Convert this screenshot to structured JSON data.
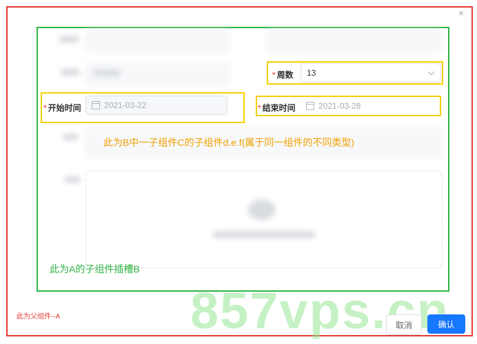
{
  "dialog": {
    "close_symbol": "×",
    "parent_note": "此为父组件--A",
    "slot_note": "此为A的子组件插槽B",
    "child_note": "此为B中一子组件C的子组件d.e.f(属于同一组件的不同类型)"
  },
  "form": {
    "weeks": {
      "required": "*",
      "label": "周数",
      "value": "13"
    },
    "start": {
      "required": "*",
      "label": "开始时间",
      "value": "2021-03-22"
    },
    "end": {
      "required": "*",
      "label": "结束时间",
      "value": "2021-03-28"
    }
  },
  "footer": {
    "cancel_label": "取消",
    "confirm_label": "确认"
  },
  "watermark": {
    "text": "857vps.cn"
  },
  "colors": {
    "parent_frame": "#e53935",
    "slot_frame": "#2fb344",
    "child_frame": "#f4d000",
    "primary": "#1677ff"
  }
}
